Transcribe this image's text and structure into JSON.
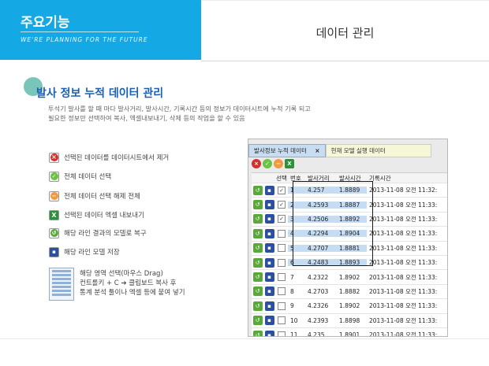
{
  "header": {
    "title": "주요기능",
    "subtitle": "WE'RE PLANNING FOR THE FUTURE",
    "section": "데이터 관리"
  },
  "main": {
    "title": "발사 정보 누적 데이터 관리",
    "desc_line1": "투석기 발사를 할 때 마다 발사거리, 발사시간, 기록시간 등의 정보가 데이터시트에 누적 기록 되고",
    "desc_line2": "필요한 정보만 선택하여 복사, 엑셀내보내기, 삭제 등의 작업을 할 수 있음"
  },
  "legend": [
    {
      "icon": "delete-icon",
      "label": "선택된 데이터를 데이터시트에서 제거"
    },
    {
      "icon": "select-all-icon",
      "label": "전체 데이터 선택"
    },
    {
      "icon": "deselect-all-icon",
      "label": "전체 데이터 선택 해제 전체"
    },
    {
      "icon": "excel-icon",
      "label": "선택된 데이터 엑셀 내보내기"
    },
    {
      "icon": "restore-icon",
      "label": "해당 라인 결과의 모델로 복구"
    },
    {
      "icon": "save-icon",
      "label": "해당 라인 모델 저장"
    }
  ],
  "drag": {
    "line1": "해당 영역 선택(마우스 Drag)",
    "line2": "컨트롤키 + C ➔ 클립보드 복사 후",
    "line3": "통계 분석 툴이나 엑셀 등에 붙여 넣기"
  },
  "panel": {
    "tab_active": "발사정보 누적 데이터",
    "tab_close": "×",
    "tab_inactive": "현재 모델 실행 데이터",
    "columns": [
      "선택",
      "번호",
      "발사거리",
      "발사시간",
      "기록시간"
    ],
    "rows": [
      {
        "checked": true,
        "no": "1",
        "dist": "4.257",
        "time": "1.8889",
        "rec": "2013-11-08 오전 11:32:"
      },
      {
        "checked": true,
        "no": "2",
        "dist": "4.2593",
        "time": "1.8887",
        "rec": "2013-11-08 오전 11:33:"
      },
      {
        "checked": true,
        "no": "3",
        "dist": "4.2506",
        "time": "1.8892",
        "rec": "2013-11-08 오전 11:33:"
      },
      {
        "checked": false,
        "no": "4",
        "dist": "4.2294",
        "time": "1.8904",
        "rec": "2013-11-08 오전 11:33:"
      },
      {
        "checked": false,
        "no": "5",
        "dist": "4.2707",
        "time": "1.8881",
        "rec": "2013-11-08 오전 11:33:"
      },
      {
        "checked": false,
        "no": "6",
        "dist": "4.2483",
        "time": "1.8893",
        "rec": "2013-11-08 오전 11:33:"
      },
      {
        "checked": false,
        "no": "7",
        "dist": "4.2322",
        "time": "1.8902",
        "rec": "2013-11-08 오전 11:33:"
      },
      {
        "checked": false,
        "no": "8",
        "dist": "4.2703",
        "time": "1.8882",
        "rec": "2013-11-08 오전 11:33:"
      },
      {
        "checked": false,
        "no": "9",
        "dist": "4.2326",
        "time": "1.8902",
        "rec": "2013-11-08 오전 11:33:"
      },
      {
        "checked": false,
        "no": "10",
        "dist": "4.2393",
        "time": "1.8898",
        "rec": "2013-11-08 오전 11:33:"
      },
      {
        "checked": false,
        "no": "11",
        "dist": "4.235",
        "time": "1.8901",
        "rec": "2013-11-08 오전 11:33:"
      }
    ],
    "selected_rows": 6
  }
}
